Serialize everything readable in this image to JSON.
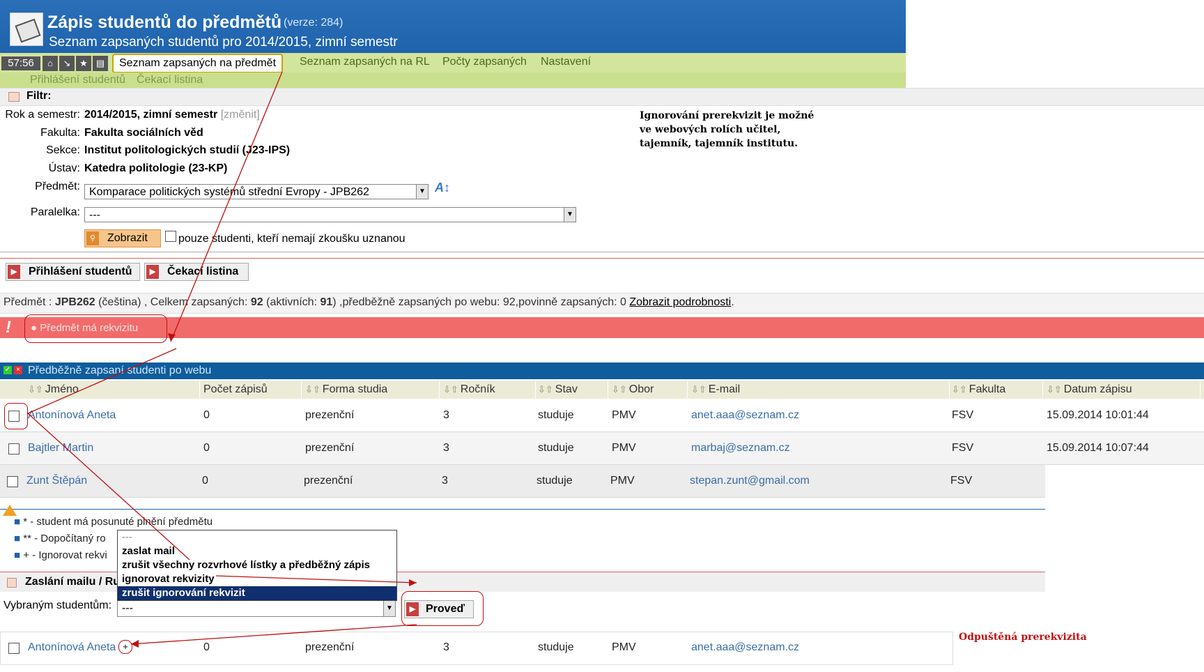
{
  "header": {
    "title": "Zápis studentů do předmětů",
    "version": "(verze: 284)",
    "subtitle": "Seznam zapsaných studentů pro 2014/2015, zimní semestr",
    "timer": "57:56"
  },
  "menu": {
    "active": "Seznam zapsaných na předmět",
    "items": [
      "Seznam zapsaných na RL",
      "Počty zapsaných",
      "Nastavení"
    ],
    "sub_items": [
      "Přihlášení studentů",
      "Čekací listina"
    ]
  },
  "filter": {
    "bar_label": "Filtr:",
    "rok_label": "Rok a semestr:",
    "rok_value": "2014/2015, zimní semestr",
    "zmenit": "[změnit]",
    "fakulta_label": "Fakulta:",
    "fakulta_value": "Fakulta sociálních věd",
    "sekce_label": "Sekce:",
    "sekce_value": "Institut politologických studií (J23-IPS)",
    "ustav_label": "Ústav:",
    "ustav_value": "Katedra politologie (23-KP)",
    "predmet_label": "Předmět:",
    "predmet_value": "Komparace politických systémů střední Evropy - JPB262",
    "paralelka_label": "Paralelka:",
    "paralelka_value": "---",
    "show_button": "Zobrazit",
    "checkbox_label": "pouze studenti, kteří nemají zkoušku uznanou"
  },
  "note_box": "Ignorování prerekvizit je možné ve webových rolích učitel, tajemník, tajemník institutu.",
  "actions": {
    "prihlaseni": "Přihlášení studentů",
    "cekaci": "Čekací listina"
  },
  "info": {
    "predmet_label": "Předmět :",
    "code": "JPB262",
    "lang": "(čeština) , Celkem zapsaných:",
    "celkem": "92",
    "aktivnich_label": "(aktivních:",
    "aktivnich": "91",
    "rest": ") ,předběžně zapsaných po webu: 92,povinně zapsaných: 0",
    "detail_link": "Zobrazit podrobnosti",
    "dot": "."
  },
  "alert": "Předmět má rekvizitu",
  "table": {
    "title": "Předběžně zapsaní studenti po webu",
    "columns": [
      "Jméno",
      "Počet zápisů",
      "Forma studia",
      "Ročník",
      "Stav",
      "Obor",
      "E-mail",
      "Fakulta",
      "Datum zápisu"
    ],
    "rows": [
      [
        "Antonínová Aneta",
        "0",
        "prezenční",
        "3",
        "studuje",
        "PMV",
        "anet.aaa@seznam.cz",
        "FSV",
        "15.09.2014 10:01:44"
      ],
      [
        "Bajtler Martin",
        "0",
        "prezenční",
        "3",
        "studuje",
        "PMV",
        "marbaj@seznam.cz",
        "FSV",
        "15.09.2014 10:07:44"
      ],
      [
        "Zunt Štěpán",
        "0",
        "prezenční",
        "3",
        "studuje",
        "PMV",
        "stepan.zunt@gmail.com",
        "FSV",
        ""
      ]
    ]
  },
  "legend": [
    "* - student má posunuté plnění předmětu",
    "** - Dopočítaný ro",
    "+ - Ignorovat rekvi"
  ],
  "mail": {
    "section_label": "Zaslání mailu / Ru",
    "vybranym_label": "Vybraným studentům:",
    "select_value": "---",
    "proved_button": "Proveď",
    "dropdown_options": [
      "---",
      "zaslat mail",
      "zrušit všechny rozvrhové lístky a předběžný zápis",
      "ignorovat rekvizity",
      "zrušit ignorování rekvizit"
    ]
  },
  "bottom_row": [
    "Antonínová Aneta",
    "+",
    "0",
    "prezenční",
    "3",
    "studuje",
    "PMV",
    "anet.aaa@seznam.cz"
  ],
  "annotation_red": "Odpuštěná prerekvizita",
  "colors": {
    "header": "#2166b0",
    "menu": "#d3e49d",
    "alert": "#f26b6b",
    "table_header": "#0f5d9c",
    "dropdown_selected": "#0f2f6e"
  }
}
